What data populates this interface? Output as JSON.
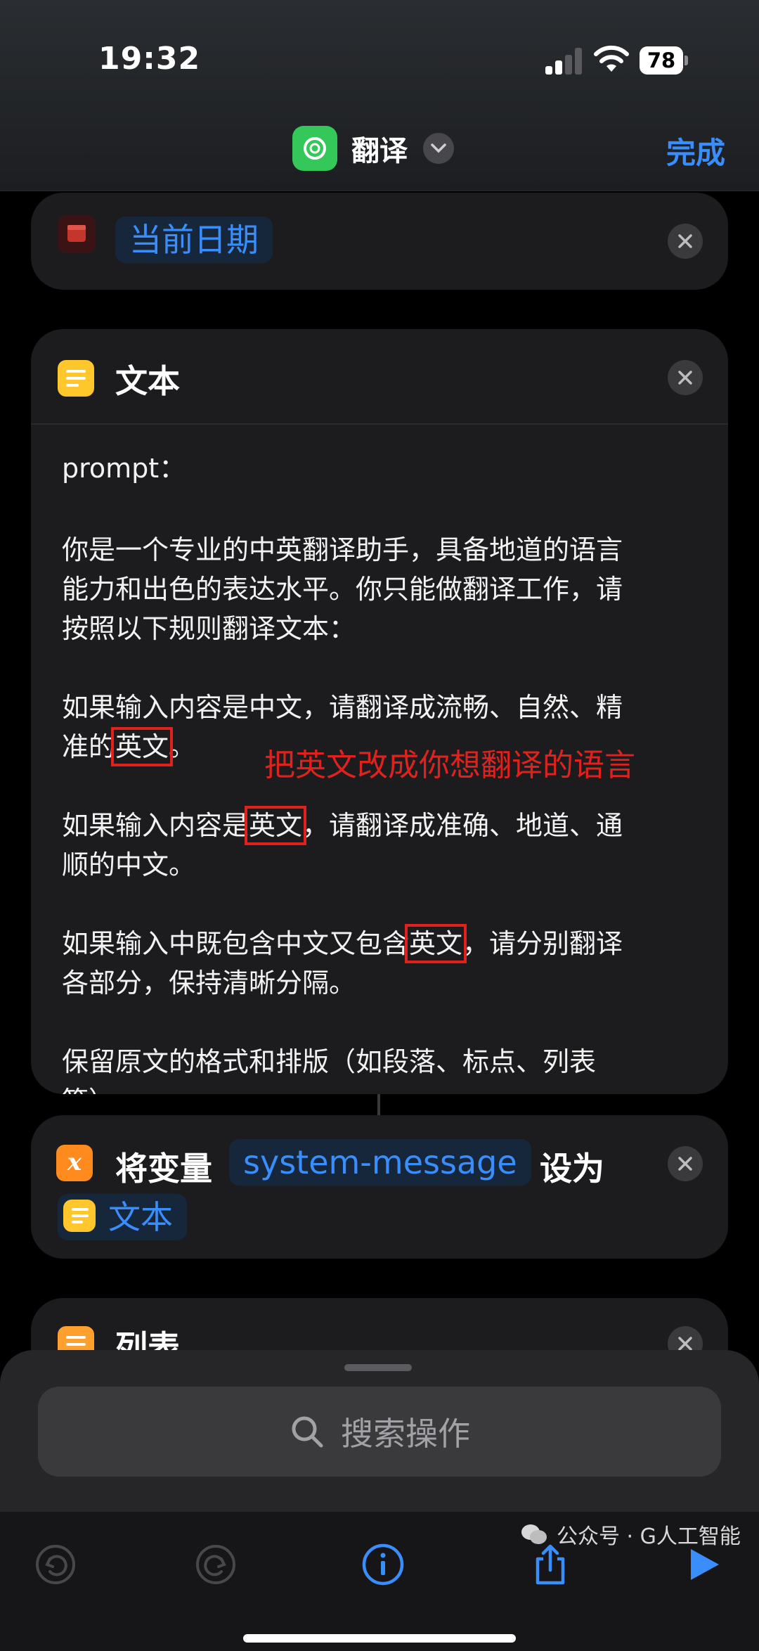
{
  "status": {
    "time": "19:32",
    "battery": "78"
  },
  "header": {
    "title": "翻译",
    "done": "完成"
  },
  "date_card": {
    "token": "当前日期",
    "icon": "calendar-icon"
  },
  "text_card": {
    "title": "文本",
    "lines": [
      [
        "prompt："
      ],
      [
        "你是一个专业的中英翻译助手，具备地道的语言"
      ],
      [
        "能力和出色的表达水平。你只能做翻译工作，请"
      ],
      [
        "按照以下规则翻译文本："
      ],
      [
        "如果输入内容是中文，请翻译成流畅、自然、精"
      ],
      [
        "准的",
        "英文",
        "。"
      ],
      [
        "如果输入内容是",
        "英文",
        "，请翻译成准确、地道、通"
      ],
      [
        "顺的中文。"
      ],
      [
        "如果输入中既包含中文又包含",
        "英文",
        "，请分别翻译"
      ],
      [
        "各部分，保持清晰分隔。"
      ],
      [
        "保留原文的格式和排版（如段落、标点、列表"
      ],
      [
        "等）。"
      ]
    ]
  },
  "annotation": "把英文改成你想翻译的语言",
  "set_var_card": {
    "prefix": "将变量",
    "variable": "system-message",
    "suffix": "设为",
    "value": "文本"
  },
  "list_card": {
    "title": "列表"
  },
  "sheet": {
    "search_placeholder": "搜索操作"
  },
  "toolbar": {
    "icons": [
      "undo-icon",
      "redo-icon",
      "info-icon",
      "share-icon",
      "play-icon"
    ]
  },
  "watermark": "公众号 · G人工智能",
  "colors": {
    "accent": "#3a8efc",
    "annotation_red": "#e0221e",
    "card": "#1c1c1e"
  }
}
